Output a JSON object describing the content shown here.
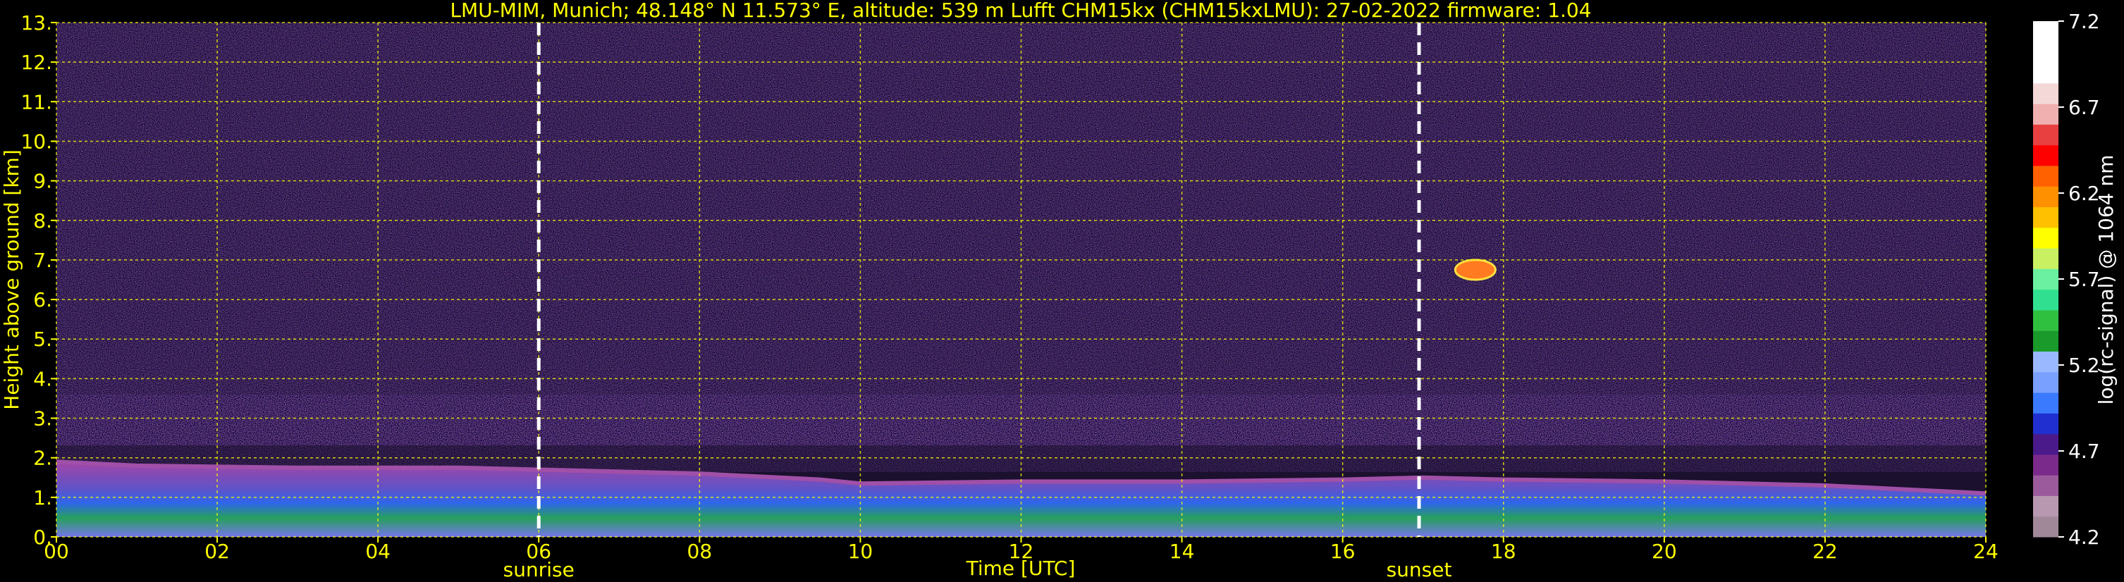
{
  "colors": {
    "background": "#000000",
    "text": "#ffff00",
    "grid": "#ffff00",
    "marker_line": "#ffffff",
    "colorbar_text": "#ffffff"
  },
  "chart_data": {
    "type": "heatmap",
    "title": "LMU-MIM, Munich; 48.148° N 11.573° E, altitude: 539 m    Lufft CHM15kx (CHM15kxLMU): 27-02-2022    firmware: 1.04",
    "xlabel": "Time [UTC]",
    "ylabel": "Height above ground [km]",
    "xlim": [
      0,
      24
    ],
    "ylim": [
      0,
      13
    ],
    "x_ticks": [
      "00",
      "02",
      "04",
      "06",
      "08",
      "10",
      "12",
      "14",
      "16",
      "18",
      "20",
      "22",
      "24"
    ],
    "y_ticks": [
      "0.",
      "1.",
      "2.",
      "3.",
      "4.",
      "5.",
      "6.",
      "7.",
      "8.",
      "9.",
      "10.",
      "11.",
      "12.",
      "13."
    ],
    "grid": true,
    "markers": [
      {
        "label": "sunrise",
        "x": 6.0
      },
      {
        "label": "sunset",
        "x": 16.95
      }
    ],
    "colorbar": {
      "label": "log(rc-signal) @ 1064 nm",
      "range": [
        4.2,
        7.2
      ],
      "ticks": [
        "4.2",
        "4.7",
        "5.2",
        "5.7",
        "6.2",
        "6.7",
        "7.2"
      ],
      "position": "right"
    },
    "features": {
      "boundary_layer_top_km": [
        {
          "x": 0,
          "y": 1.9
        },
        {
          "x": 1,
          "y": 1.8
        },
        {
          "x": 3,
          "y": 1.75
        },
        {
          "x": 5,
          "y": 1.75
        },
        {
          "x": 6,
          "y": 1.7
        },
        {
          "x": 8,
          "y": 1.6
        },
        {
          "x": 9.5,
          "y": 1.45
        },
        {
          "x": 10,
          "y": 1.35
        },
        {
          "x": 12,
          "y": 1.4
        },
        {
          "x": 14,
          "y": 1.4
        },
        {
          "x": 16,
          "y": 1.45
        },
        {
          "x": 17,
          "y": 1.5
        },
        {
          "x": 18,
          "y": 1.45
        },
        {
          "x": 20,
          "y": 1.4
        },
        {
          "x": 22,
          "y": 1.3
        },
        {
          "x": 24,
          "y": 1.1
        }
      ],
      "cloud_patch": {
        "time_range": [
          17.4,
          17.9
        ],
        "height_range_km": [
          6.5,
          7.0
        ]
      }
    }
  }
}
